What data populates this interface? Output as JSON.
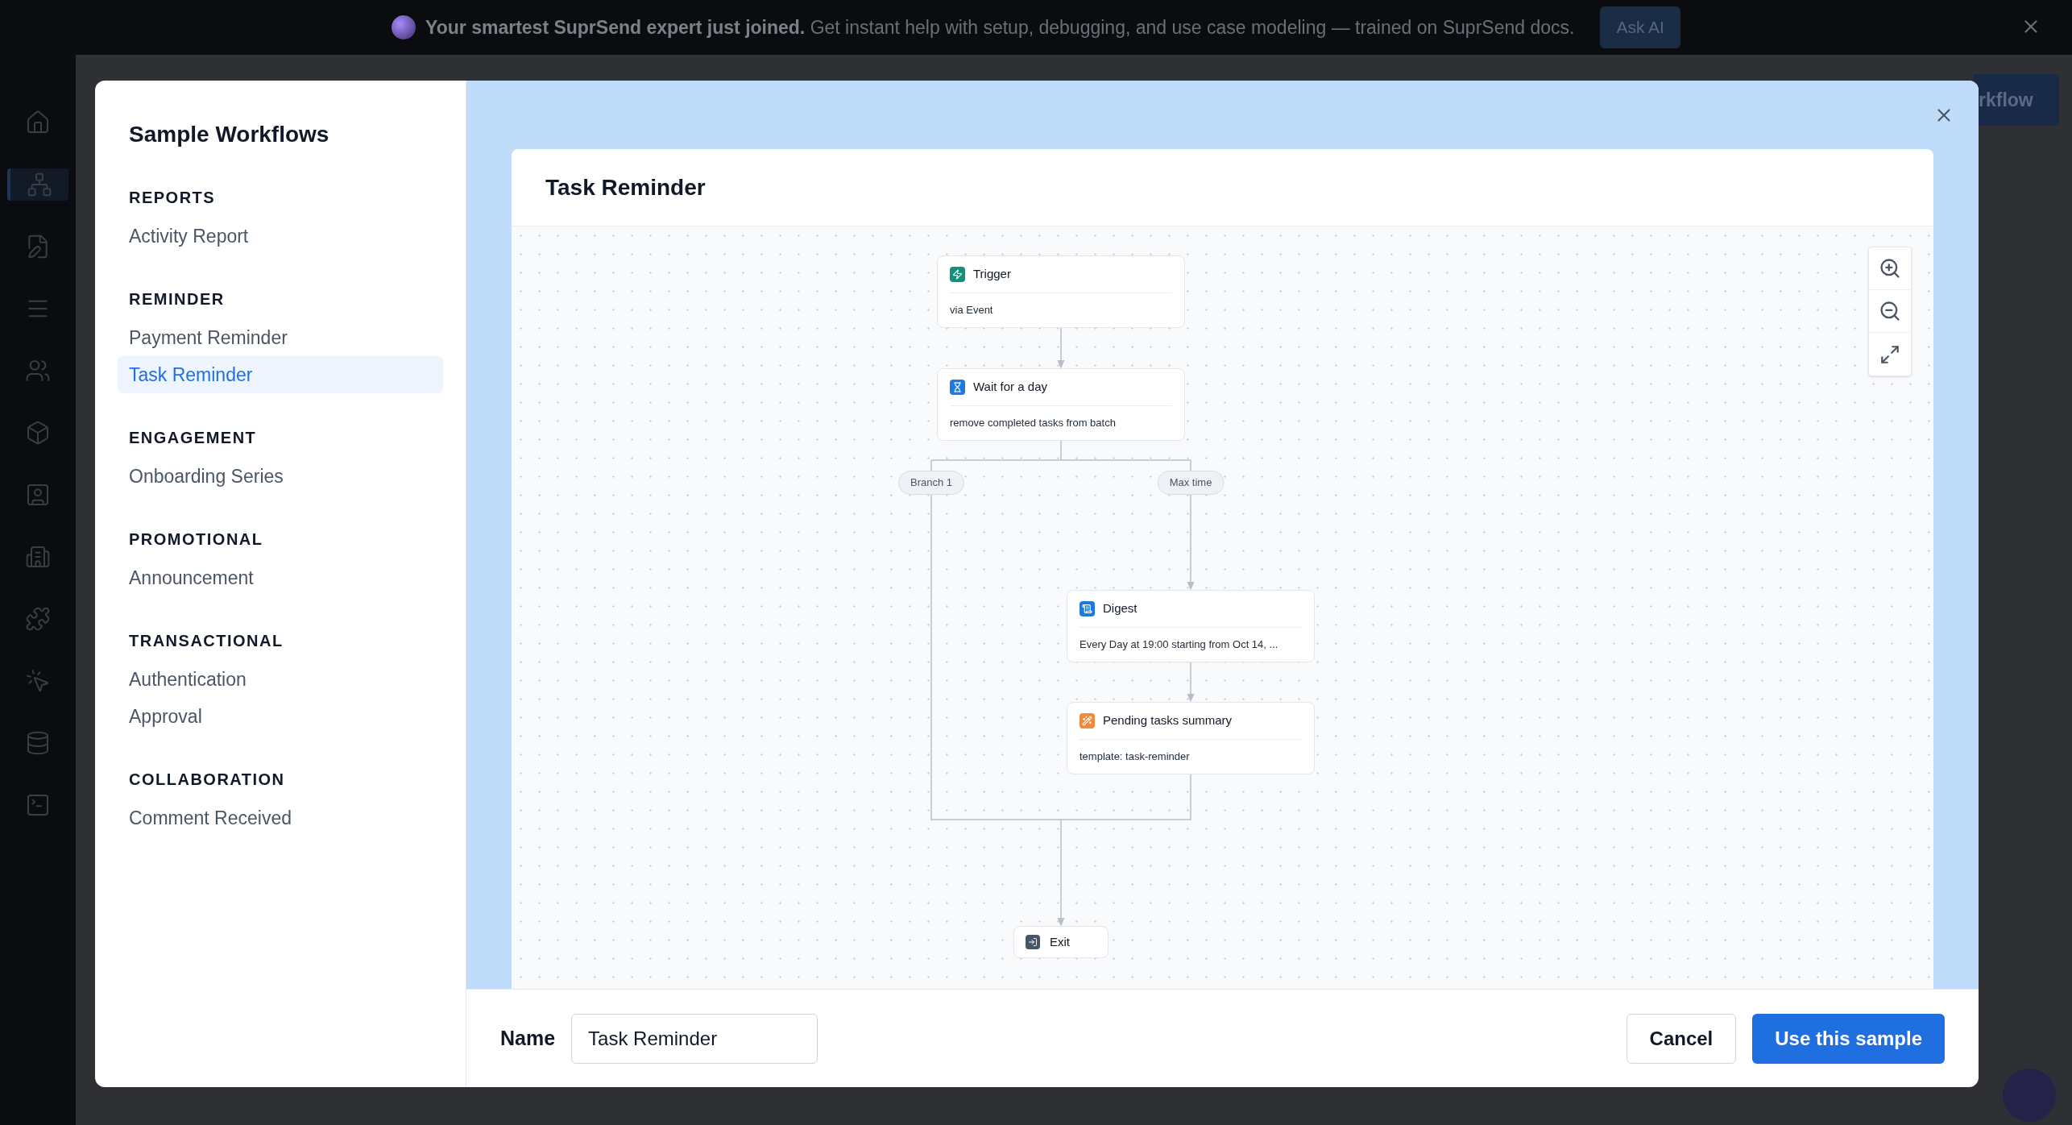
{
  "banner": {
    "headline": "Your smartest SuprSend expert just joined.",
    "message": "Get instant help with setup, debugging, and use case modeling — trained on SuprSend docs.",
    "action": "Ask AI"
  },
  "nav_items": [
    {
      "kind": "home",
      "selected": false
    },
    {
      "kind": "workflows",
      "selected": true
    },
    {
      "kind": "templates",
      "selected": false
    },
    {
      "kind": "logs",
      "selected": false
    },
    {
      "kind": "users",
      "selected": false
    },
    {
      "kind": "objects",
      "selected": false
    },
    {
      "kind": "contacts",
      "selected": false
    },
    {
      "kind": "tenants",
      "selected": false
    },
    {
      "kind": "integrations",
      "selected": false
    },
    {
      "kind": "events",
      "selected": false
    },
    {
      "kind": "database",
      "selected": false
    },
    {
      "kind": "console",
      "selected": false
    }
  ],
  "background_button": "rkflow",
  "modal": {
    "title": "Sample Workflows",
    "sections": [
      {
        "heading": "REPORTS",
        "items": [
          {
            "label": "Activity Report",
            "selected": false
          }
        ]
      },
      {
        "heading": "REMINDER",
        "items": [
          {
            "label": "Payment Reminder",
            "selected": false
          },
          {
            "label": "Task Reminder",
            "selected": true
          }
        ]
      },
      {
        "heading": "ENGAGEMENT",
        "items": [
          {
            "label": "Onboarding Series",
            "selected": false
          }
        ]
      },
      {
        "heading": "PROMOTIONAL",
        "items": [
          {
            "label": "Announcement",
            "selected": false
          }
        ]
      },
      {
        "heading": "TRANSACTIONAL",
        "items": [
          {
            "label": "Authentication",
            "selected": false
          },
          {
            "label": "Approval",
            "selected": false
          }
        ]
      },
      {
        "heading": "COLLABORATION",
        "items": [
          {
            "label": "Comment Received",
            "selected": false
          }
        ]
      }
    ],
    "preview": {
      "title": "Task Reminder",
      "nodes": [
        {
          "kind": "trigger",
          "title": "Trigger",
          "subtitle": "via Event"
        },
        {
          "kind": "wait",
          "title": "Wait for a day",
          "subtitle": "remove completed tasks from batch"
        },
        {
          "kind": "digest",
          "title": "Digest",
          "subtitle": "Every Day at 19:00 starting from Oct 14, ..."
        },
        {
          "kind": "template",
          "title": "Pending tasks summary",
          "subtitle": "template: task-reminder"
        },
        {
          "kind": "exit",
          "title": "Exit"
        }
      ],
      "branches": [
        "Branch 1",
        "Max time"
      ]
    },
    "name_label": "Name",
    "name_value": "Task Reminder",
    "cancel": "Cancel",
    "submit": "Use this sample"
  }
}
